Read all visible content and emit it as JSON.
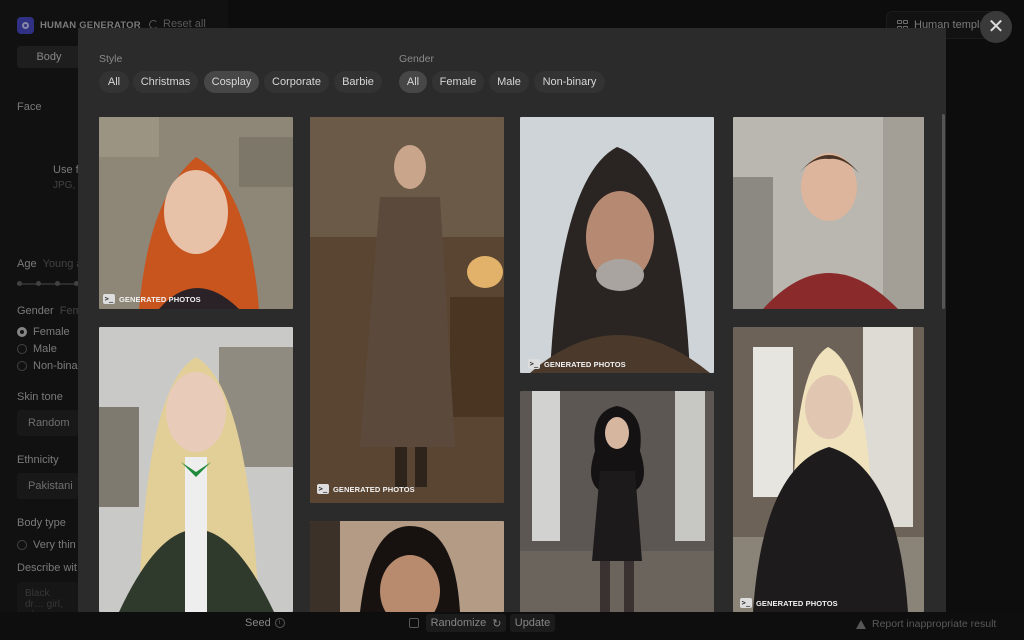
{
  "app": {
    "logo_text": "HUMAN GENERATOR",
    "reset_label": "Reset all"
  },
  "sidebar": {
    "tab_body": "Body",
    "face_label": "Face",
    "use_text": "Use f",
    "use_sub": "JPG,",
    "age_label": "Age",
    "age_value": "Young a",
    "gender_label": "Gender",
    "gender_value": "Fem",
    "gender_options": [
      "Female",
      "Male",
      "Non-bina"
    ],
    "skin_label": "Skin tone",
    "skin_value": "Random",
    "ethnicity_label": "Ethnicity",
    "ethnicity_value": "Pakistani",
    "body_label": "Body type",
    "body_option": "Very thin",
    "describe_label": "Describe wit",
    "describe_placeholder": "Black dr… girl, rdr"
  },
  "bottom": {
    "seed_label": "Seed",
    "randomize_label": "Randomize",
    "update_label": "Update",
    "report_label": "Report inappropriate result"
  },
  "header": {
    "templates_label": "Human templa"
  },
  "modal": {
    "style_label": "Style",
    "style_chips": [
      "All",
      "Christmas",
      "Cosplay",
      "Corporate",
      "Barbie"
    ],
    "style_active": "Cosplay",
    "gender_label": "Gender",
    "gender_chips": [
      "All",
      "Female",
      "Male",
      "Non-binary"
    ],
    "gender_active": "All",
    "watermark": "GENERATED PHOTOS",
    "photos": [
      "Red-haired woman by stone wall",
      "Elderly man in long coat",
      "Long-haired grey-bearded man",
      "Young man in red sweater",
      "Blonde woman in green robe",
      "Woman with dark hair",
      "Dark-haired woman in black dress",
      "Platinum-haired man in leather"
    ]
  },
  "colors": {
    "accent": "#4a4cc9",
    "modal_bg": "#2b2b2b",
    "chip_active": "#474747"
  }
}
